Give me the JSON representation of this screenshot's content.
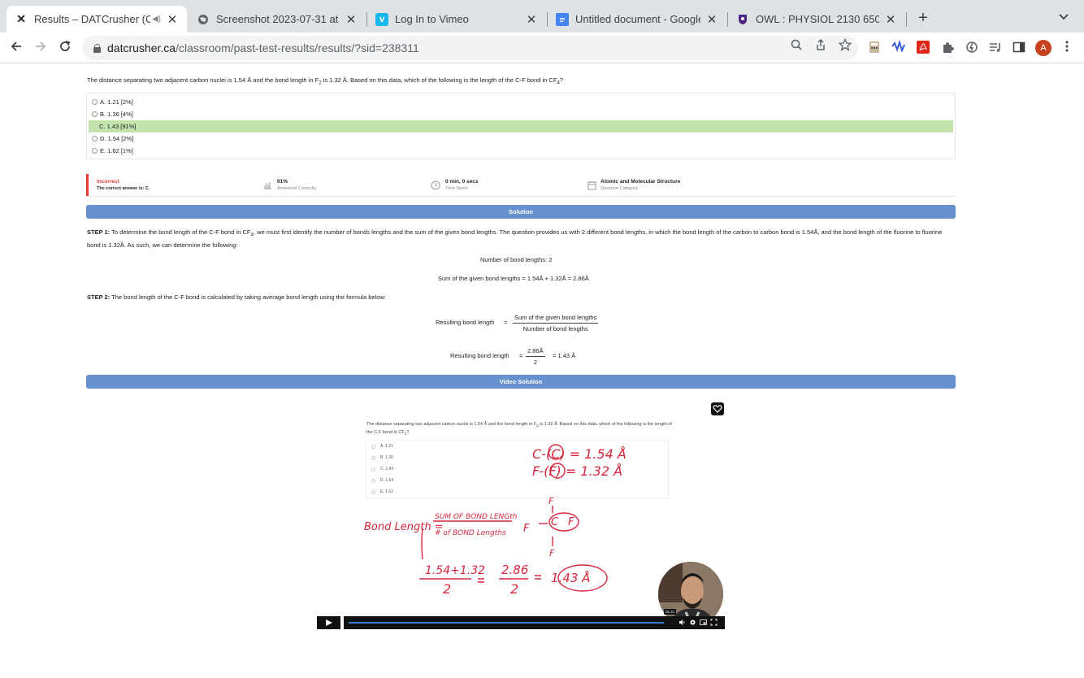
{
  "tabs": [
    {
      "title": "Results – DATCrusher (Car",
      "active": true,
      "favicon": "datcrusher-logo-icon"
    },
    {
      "title": "Screenshot 2023-07-31 at 5.0",
      "favicon": "globe-icon"
    },
    {
      "title": "Log In to Vimeo",
      "favicon": "vimeo-icon"
    },
    {
      "title": "Untitled document - Google D",
      "favicon": "google-docs-icon"
    },
    {
      "title": "OWL : PHYSIOL 2130 650 SU2",
      "favicon": "owl-shield-icon"
    }
  ],
  "address_bar": {
    "host": "datcrusher.ca",
    "path": "/classroom/past-test-results/results/?sid=238311"
  },
  "profile_initial": "A",
  "question": {
    "text_before_f2": "The distance separating two adjacent carbon nuclei is 1.54 Å and the bond length in F",
    "f2_sub": "2",
    "text_middle": " is 1.32 Å. Based on this data, which of the following is the length of the C-F bond in CF",
    "cf4_sub": "4",
    "text_end": "?"
  },
  "choices": [
    {
      "label": "A. 1.21 [2%]",
      "correct": false
    },
    {
      "label": "B. 1.36 [4%]",
      "correct": false
    },
    {
      "label": "C. 1.43 [91%]",
      "correct": true
    },
    {
      "label": "D. 1.54 [2%]",
      "correct": false
    },
    {
      "label": "E. 1.62 [1%]",
      "correct": false
    }
  ],
  "result": {
    "status": "Incorrect",
    "correct_answer_text": "The correct answer is: C.",
    "percent": "91%",
    "percent_label": "Answered Correctly",
    "time": "0 min, 0 secs",
    "time_label": "Time Spent",
    "category": "Atomic and Molecular Structure",
    "category_label": "Question Category"
  },
  "solution": {
    "banner": "Solution",
    "step1_label": "STEP 1:",
    "step1_text_a": " To determine the bond length of the C-F bond in CF",
    "step1_sub": "4",
    "step1_text_b": ", we must first identify the number of bonds lengths and the sum of the given bond lengths. The question provides us with 2 different bond lengths, in which the bond length of the carbon to carbon bond is 1.54Å, and the bond length of the fluorine to fluorine bond is 1.32Å. As such, we can determine the following:",
    "eq_count": "Number of bond lengths: 2",
    "eq_sum": "Sum of the given bond lengths = 1.54Å + 1.32Å = 2.86Å",
    "step2_label": "STEP 2:",
    "step2_text": " The bond length of the C-F bond is calculated by taking average bond length using the formula below:",
    "formula_lhs": "Resulting bond length",
    "formula_eq": "=",
    "formula_num": "Sum of the given bond lengths",
    "formula_den": "Number of bond lengths",
    "result_lhs": "Resulting bond length",
    "result_eq": "=",
    "result_num": "2.86Å",
    "result_den": "2",
    "result_rhs": "= 1.43 Å"
  },
  "video": {
    "banner": "Video Solution",
    "question_a": "The distance separating two adjacent carbon nuclei is 1.54 Å and the bond length in F",
    "question_sub1": "2",
    "question_b": " is 1.32 Å. Based on this data, which of the following is the length of the C-F bond in CF",
    "question_sub2": "4",
    "question_c": "?",
    "choices": [
      "A. 1.21",
      "B. 1.36",
      "C. 1.43",
      "D. 1.54",
      "E. 1.62"
    ],
    "timestamp": "01:21",
    "progress": 0.85,
    "handwriting": {
      "c_line": "C-(C) = 1.54 Å",
      "f_line": "F-(F) = 1.32 Å",
      "bond_length_label": "Bond Length =",
      "numerator": "SUM OF BOND LENGth",
      "denominator": "# of BOND Lengths",
      "calc_num": "1.54+1.32",
      "calc_den": "2",
      "mid_num": "2.86",
      "mid_den": "2",
      "answer": "1.43 Å",
      "atom_f_top": "F",
      "atom_f_left": "F",
      "atom_c": "C",
      "atom_f_right": "F",
      "atom_f_bottom": "F"
    }
  }
}
